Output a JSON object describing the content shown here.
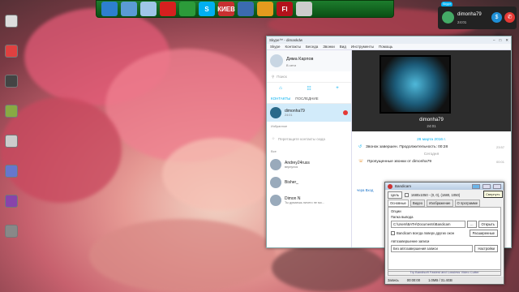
{
  "desktop": {
    "icons": [
      {
        "label": "",
        "color": "#dddddd"
      },
      {
        "label": "",
        "color": "#e04040"
      },
      {
        "label": "",
        "color": "#444444"
      },
      {
        "label": "",
        "color": "#88aa44"
      },
      {
        "label": "",
        "color": "#cccccc"
      },
      {
        "label": "",
        "color": "#6677cc"
      },
      {
        "label": "",
        "color": "#8844aa"
      },
      {
        "label": "",
        "color": "#888888"
      }
    ]
  },
  "dock": {
    "items": [
      {
        "label": "",
        "icon": "windows-icon",
        "color": "#2d7fcf"
      },
      {
        "label": "",
        "icon": "control-panel-icon",
        "color": "#5a9bd5"
      },
      {
        "label": "",
        "icon": "notepad-icon",
        "color": "#9fc6e8"
      },
      {
        "label": "",
        "icon": "opera-icon",
        "color": "#d6201f"
      },
      {
        "label": "",
        "icon": "utorrent-icon",
        "color": "#2c9b3a"
      },
      {
        "label": "S",
        "icon": "skype-icon",
        "color": "#00aff0"
      },
      {
        "label": "КИЕВ",
        "icon": "kiev-icon",
        "color": "#c83030"
      },
      {
        "label": "",
        "icon": "media-player-icon",
        "color": "#3b6bb0"
      },
      {
        "label": "",
        "icon": "fl-studio-icon",
        "color": "#e39b1e"
      },
      {
        "label": "Fl",
        "icon": "flash-icon",
        "color": "#b3121b"
      },
      {
        "label": "",
        "icon": "disk-icon",
        "color": "#cccccc"
      }
    ]
  },
  "notification": {
    "logo": "Skype",
    "name": "dimonha79",
    "time": "24:01"
  },
  "skype": {
    "title": "Skype™ - dimaskdw",
    "menu": [
      "Skype",
      "Контакты",
      "Беседа",
      "Звонки",
      "Вид",
      "Инструменты",
      "Помощь"
    ],
    "profile": {
      "name": "Дима Карпов",
      "status": "В сети"
    },
    "search_placeholder": "Поиск",
    "tabs": {
      "contacts": "КОНТАКТЫ",
      "recent": "ПОСЛЕДНИЕ"
    },
    "selected_contact": {
      "name": "dimonha79",
      "sub": "24:01"
    },
    "favorites_label": "Избранное",
    "favorites_hint": "Перетащите контакты сюда",
    "all_label": "Все",
    "contacts": [
      {
        "name": "Andrey24russ",
        "sub": "вернулся"
      },
      {
        "name": "Bisher_",
        "sub": ""
      },
      {
        "name": "Dimon N",
        "sub": "Ты думаешь ничего не мо..."
      }
    ],
    "chat": {
      "header_name": "dimonha79",
      "header_time": "24:01",
      "date1": "26 марта 2016 г.",
      "msg1": "Звонок завершен. Продолжительность: 00:28",
      "msg1_time": "23:57",
      "date2": "Сегодня",
      "msg2": "Пропущенные звонки от dimonha79",
      "msg2_time": "00:01"
    },
    "plugin_text": "чера Вход"
  },
  "bandicam": {
    "title": "Bandicam",
    "target_button": "Цель",
    "resolution": "1680x1050 - (0, 0), (1680, 1050)",
    "tabs": [
      "Основные",
      "Видео",
      "Изображение",
      "О программе"
    ],
    "section_options": "Опции",
    "output_label": "Папка вывода",
    "output_path": "C:\\Users\\BATH\\Documents\\Bandicam",
    "open_button": "Открыть",
    "on_top_label": "Bandicam всегда поверх других окон",
    "advanced_button": "Расширенные",
    "autostart_label": "Автозавершение записи",
    "autostart_value": "Без автозавершения записи",
    "settings_button": "Настройки",
    "promo": "Try Bandisoft Fastest and Lossless Video Cutter",
    "status_rec": "Запись",
    "status_time": "00:00:00",
    "status_size": "1.0MB / 31.4GB",
    "tooltip": "Свернуть"
  }
}
